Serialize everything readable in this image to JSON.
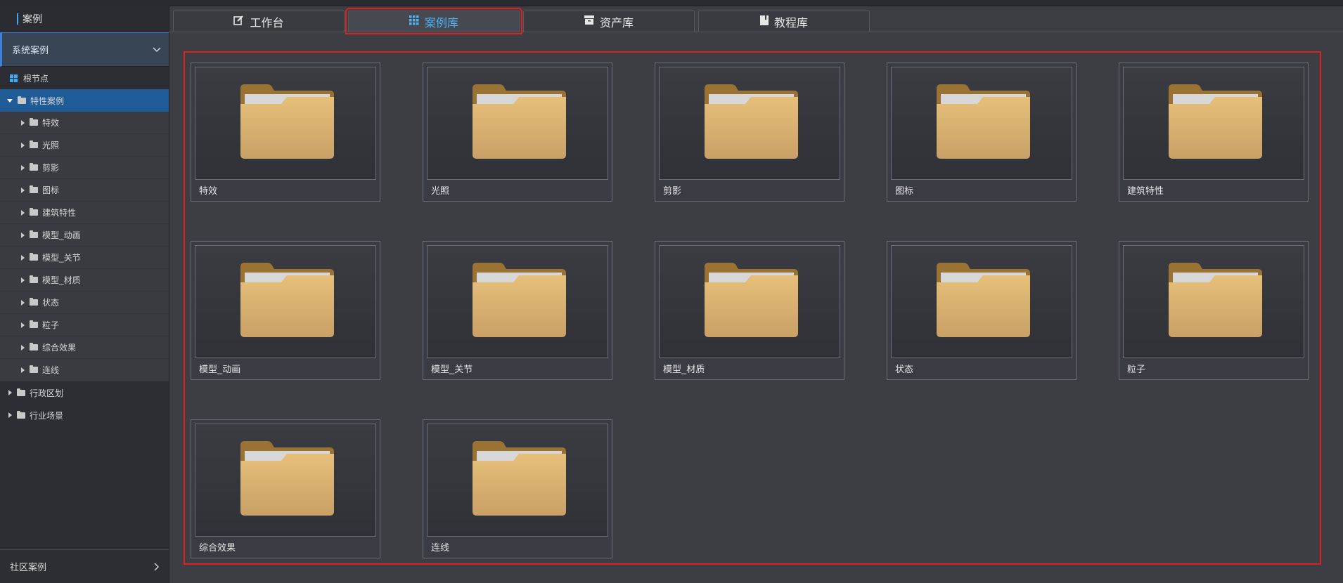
{
  "sidebar": {
    "header": "案例",
    "section": "系统案例",
    "root": "根节点",
    "selected": "特性案例",
    "children": [
      "特效",
      "光照",
      "剪影",
      "图标",
      "建筑特性",
      "模型_动画",
      "模型_关节",
      "模型_材质",
      "状态",
      "粒子",
      "综合效果",
      "连线"
    ],
    "top_items": [
      "行政区划",
      "行业场景"
    ],
    "footer": "社区案例"
  },
  "tabs": [
    {
      "label": "工作台",
      "icon": "edit-icon"
    },
    {
      "label": "案例库",
      "icon": "grid-icon"
    },
    {
      "label": "资产库",
      "icon": "box-icon"
    },
    {
      "label": "教程库",
      "icon": "book-icon"
    }
  ],
  "active_tab": 1,
  "cards": [
    "特效",
    "光照",
    "剪影",
    "图标",
    "建筑特性",
    "模型_动画",
    "模型_关节",
    "模型_材质",
    "状态",
    "粒子",
    "综合效果",
    "连线"
  ],
  "colors": {
    "accent": "#3fa9f5",
    "highlight": "#e02020",
    "selected_bg": "#1f5b96",
    "folder": "#d9b36c"
  }
}
